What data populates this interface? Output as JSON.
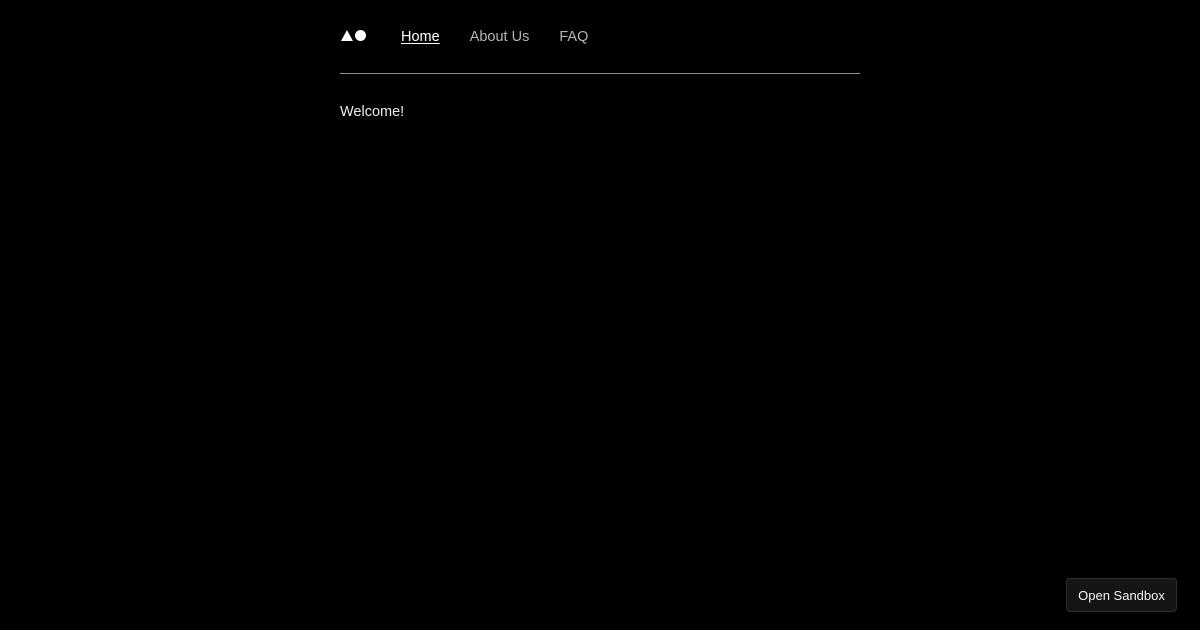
{
  "header": {
    "logo_icons": [
      "triangle-icon",
      "circle-icon"
    ],
    "nav": [
      {
        "label": "Home",
        "active": true
      },
      {
        "label": "About Us",
        "active": false
      },
      {
        "label": "FAQ",
        "active": false
      }
    ]
  },
  "main": {
    "welcome_text": "Welcome!"
  },
  "floating": {
    "open_sandbox_label": "Open Sandbox"
  },
  "colors": {
    "background": "#000000",
    "nav_active": "#ffffff",
    "nav_inactive": "#b5b5b5",
    "divider": "#8c8c8c",
    "button_bg": "#151515"
  }
}
